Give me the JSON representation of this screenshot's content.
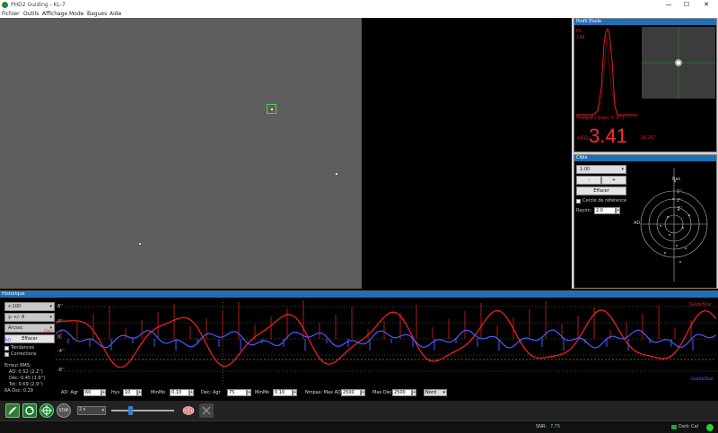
{
  "window": {
    "title": "PHD2 Guiding - KL-7",
    "minimize": "—",
    "maximize": "☐",
    "close": "✕"
  },
  "menu": [
    "Fichier",
    "Outils",
    "Affichage",
    "Mode",
    "Bagues",
    "Aide"
  ],
  "profile": {
    "header": "Profil Étoile",
    "peak_label": "Pic",
    "peak_value": "146",
    "fwhm_caption": "Intégré | Demi Y: 2'' |",
    "hfd_label": "HFD:",
    "hfd_value": "3.41",
    "hfd_arcsec": "16.20''"
  },
  "target": {
    "header": "Cible",
    "zoom_select": "1:00",
    "minus": "-",
    "plus": "+",
    "clear": "Effacer",
    "reference_circle": "Cercle de référence",
    "radius_label": "Rayon:",
    "radius_value": "2.0",
    "ring_labels": [
      "Bas",
      "1''",
      "2''",
      "3''",
      "AD"
    ]
  },
  "guiding": {
    "header": "Historique",
    "scale_select": "x:100",
    "y_select": "y: +/- 8",
    "units_select": "Arcsec",
    "clear_button": "Effacer",
    "ra_label": "AD",
    "dec_label": "Déc",
    "trends_label": "Tendances",
    "corrections_label": "Corrections",
    "rms_title": "Erreur RMS:",
    "rms_ra": "AD: 0.52 (2.2'')",
    "rms_dec": "Déc: 0.45 (1.9'')",
    "rms_tot": "Tot: 0.69 (2.9'')",
    "ra_osc": "RA Osc: 0.29",
    "y_ticks": [
      "8''",
      "4''",
      "0",
      "-4''",
      "-8''"
    ],
    "legend_right_top": "GuideStar",
    "legend_right_bot": "GuideStar"
  },
  "controls": {
    "ra_agr_label": "AD: Agr",
    "ra_agr_value": "60",
    "hys_label": "Hys",
    "hys_value": "10",
    "minmo_label": "MinMo",
    "minmo_value": "0.10",
    "dec_agr_label": "Déc: Agr",
    "dec_agr_value": "75",
    "minmo2_label": "MinMo",
    "minmo2_value": "0.10",
    "max_ra_label": "Nmpas: Max AD",
    "max_ra_value": "2500",
    "max_dec_label": "Max Déc",
    "max_dec_value": "2500",
    "mode_select": "Nord"
  },
  "toolbar": {
    "exposure": "2 s",
    "tools": [
      "brain-icon",
      "cross-icon"
    ]
  },
  "status": {
    "snr_label": "SNR:",
    "snr_value": "7.75",
    "dark_label": "Dark",
    "cal_label": "Cal"
  },
  "colors": {
    "ra_line": "#4a5cff",
    "dec_line": "#ff2020",
    "panel_blue": "#1d6fb8",
    "hfd_red": "#ff2a2a"
  }
}
